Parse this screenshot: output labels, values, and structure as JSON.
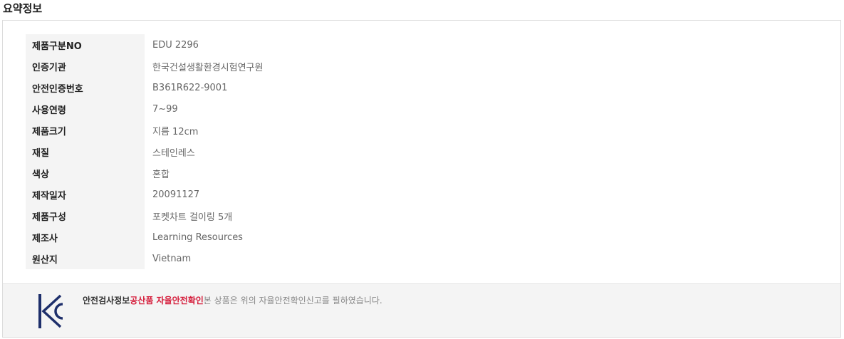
{
  "summary": {
    "title": "요약정보",
    "rows": [
      {
        "label": "제품구분NO",
        "value": "EDU 2296"
      },
      {
        "label": "인증기관",
        "value": "한국건설생활환경시험연구원"
      },
      {
        "label": "안전인증번호",
        "value": "B361R622-9001"
      },
      {
        "label": "사용연령",
        "value": "7~99"
      },
      {
        "label": "제품크기",
        "value": "지름 12cm"
      },
      {
        "label": "재질",
        "value": "스테인레스"
      },
      {
        "label": "색상",
        "value": "혼합"
      },
      {
        "label": "제작일자",
        "value": "20091127"
      },
      {
        "label": "제품구성",
        "value": "포켓차트 걸이링 5개"
      },
      {
        "label": "제조사",
        "value": "Learning Resources"
      },
      {
        "label": "원산지",
        "value": "Vietnam"
      }
    ]
  },
  "certification": {
    "heading": "안전검사정보",
    "highlight": "공산품 자율안전확인",
    "text": "본 상품은 위의 자율안전확인신고를 필하였습니다.",
    "logo_icon": "kc-mark-icon",
    "logo_color": "#1e2f6b",
    "highlight_color": "#d51d3b"
  }
}
